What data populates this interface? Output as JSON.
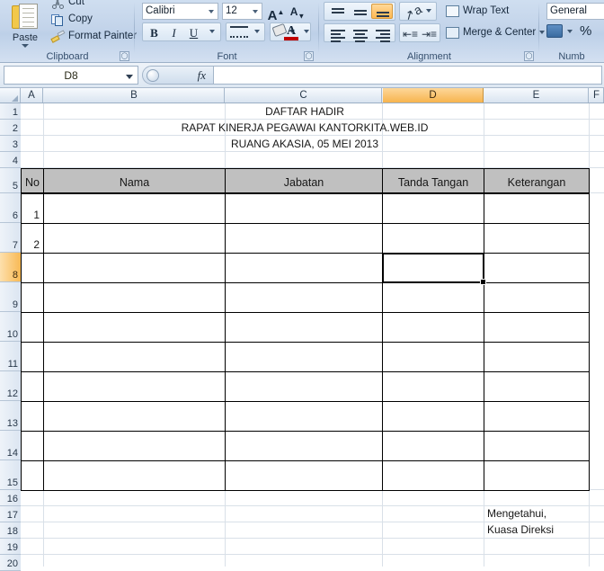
{
  "ribbon": {
    "groups": [
      {
        "name": "Clipboard",
        "label": "Clipboard"
      },
      {
        "name": "Font",
        "label": "Font"
      },
      {
        "name": "Alignment",
        "label": "Alignment"
      },
      {
        "name": "Number",
        "label": "Numb"
      }
    ],
    "clipboard": {
      "paste_label": "Paste",
      "cut_label": "Cut",
      "copy_label": "Copy",
      "format_painter_label": "Format Painter"
    },
    "font": {
      "font_name": "Calibri",
      "font_size": "12",
      "grow_font": "A",
      "shrink_font": "A",
      "bold": "B",
      "italic": "I",
      "underline": "U",
      "font_color_letter": "A"
    },
    "alignment": {
      "wrap_text_label": "Wrap Text",
      "merge_center_label": "Merge & Center"
    },
    "number": {
      "format_value": "General",
      "percent_label": "%"
    }
  },
  "formula_bar": {
    "name_box_value": "D8",
    "fx_label": "fx",
    "formula_value": ""
  },
  "grid": {
    "columns": [
      {
        "label": "A",
        "selected": false
      },
      {
        "label": "B",
        "selected": false
      },
      {
        "label": "C",
        "selected": false
      },
      {
        "label": "D",
        "selected": true
      },
      {
        "label": "E",
        "selected": false
      },
      {
        "label": "F",
        "selected": false
      }
    ],
    "rows": [
      {
        "label": "1",
        "selected": false
      },
      {
        "label": "2",
        "selected": false
      },
      {
        "label": "3",
        "selected": false
      },
      {
        "label": "4",
        "selected": false
      },
      {
        "label": "5",
        "selected": false
      },
      {
        "label": "6",
        "selected": false
      },
      {
        "label": "7",
        "selected": false
      },
      {
        "label": "8",
        "selected": true
      },
      {
        "label": "9",
        "selected": false
      },
      {
        "label": "10",
        "selected": false
      },
      {
        "label": "11",
        "selected": false
      },
      {
        "label": "12",
        "selected": false
      },
      {
        "label": "13",
        "selected": false
      },
      {
        "label": "14",
        "selected": false
      },
      {
        "label": "15",
        "selected": false
      },
      {
        "label": "16",
        "selected": false
      },
      {
        "label": "17",
        "selected": false
      },
      {
        "label": "18",
        "selected": false
      },
      {
        "label": "19",
        "selected": false
      },
      {
        "label": "20",
        "selected": false
      }
    ],
    "selected_cell": "D8"
  },
  "sheet": {
    "title_lines": [
      "DAFTAR HADIR",
      "RAPAT KINERJA PEGAWAI KANTORKITA.WEB.ID",
      "RUANG AKASIA, 05 MEI 2013"
    ],
    "table_headers": [
      "No",
      "Nama",
      "Jabatan",
      "Tanda Tangan",
      "Keterangan"
    ],
    "row_numbers": [
      "1",
      "2"
    ],
    "signature_block": [
      "Mengetahui,",
      "Kuasa Direksi"
    ]
  }
}
